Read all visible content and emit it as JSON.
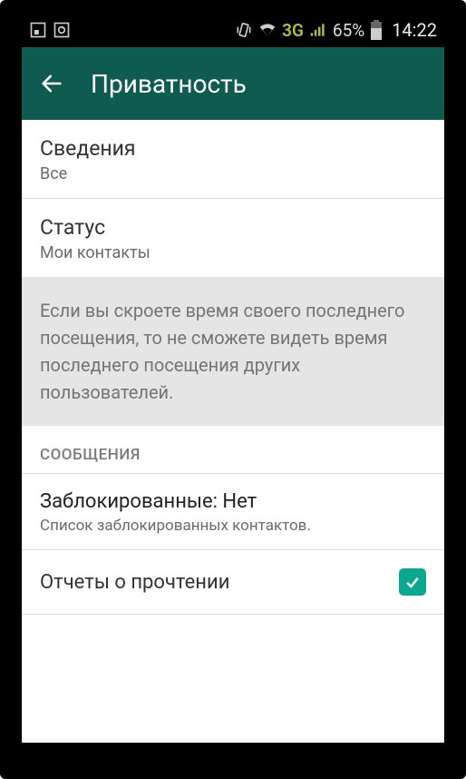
{
  "status": {
    "network_label": "3G",
    "battery_pct": "65%",
    "time": "14:22"
  },
  "appbar": {
    "title": "Приватность"
  },
  "rows": {
    "about": {
      "title": "Сведения",
      "value": "Все"
    },
    "status": {
      "title": "Статус",
      "value": "Мои контакты"
    }
  },
  "info_text": "Если вы скроете время своего последнего посещения, то не сможете видеть время последнего посещения других пользователей.",
  "section_messages": "СООБЩЕНИЯ",
  "blocked": {
    "title": "Заблокированные: Нет",
    "subtitle": "Список заблокированных контактов."
  },
  "read_receipts": {
    "title": "Отчеты о прочтении",
    "checked": true
  }
}
